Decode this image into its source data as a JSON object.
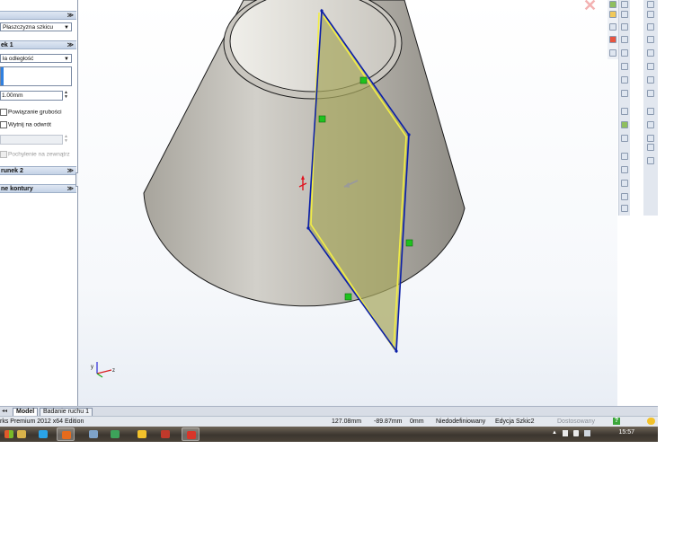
{
  "property_manager": {
    "plane_dropdown": "Płaszczyzna szkicu",
    "direction1_header": "ek 1",
    "end_condition": "ła odległość",
    "depth_value": "1.00mm",
    "link_thickness_label": "Powiązanie grubości",
    "reverse_label": "Wytnij na odwrót",
    "draft_outward_label": "Pochylenie na zewnątrz",
    "direction2_header": "runek 2",
    "contours_header": "ne kontury",
    "collapse_glyph": "≫"
  },
  "graphics": {
    "close_glyph": "✕",
    "axis_labels": {
      "x": "x",
      "y": "y",
      "z": "z"
    },
    "colors": {
      "cone_body": "#b8b5ae",
      "cone_top": "#d8d6d0",
      "sketch_plane_fill": "#a8a860",
      "sketch_line": "#0a1ea8",
      "sketch_edge_highlight": "#f2ee45",
      "relation_marker": "#1fc21f"
    }
  },
  "tabs": [
    {
      "label": "Model",
      "active": true
    },
    {
      "label": "Badanie ruchu 1",
      "active": false
    }
  ],
  "status": {
    "edition": "rks Premium 2012 x64 Edition",
    "x_coord": "127.08mm",
    "y_coord": "-89.87mm",
    "z_coord": "0mm",
    "definition_state": "Niedodefiniowany",
    "mode": "Edycja Szkic2",
    "customize": "Dostosowany",
    "help_glyph": "?"
  },
  "taskbar": {
    "time": "15:57",
    "apps": [
      {
        "name": "file-explorer-icon",
        "color": "#d9b24a",
        "active": false
      },
      {
        "name": "skype-icon",
        "color": "#2aa3e8",
        "active": false
      },
      {
        "name": "firefox-icon",
        "color": "#e66b1d",
        "active": true
      },
      {
        "name": "tool-icon",
        "color": "#7ea2c8",
        "active": false
      },
      {
        "name": "recycle-icon",
        "color": "#3da35a",
        "active": false
      },
      {
        "name": "sun-icon",
        "color": "#f3c22b",
        "active": false
      },
      {
        "name": "cube-icon",
        "color": "#c0392b",
        "active": false
      },
      {
        "name": "solidworks-icon",
        "color": "#d8352a",
        "active": true
      }
    ]
  }
}
